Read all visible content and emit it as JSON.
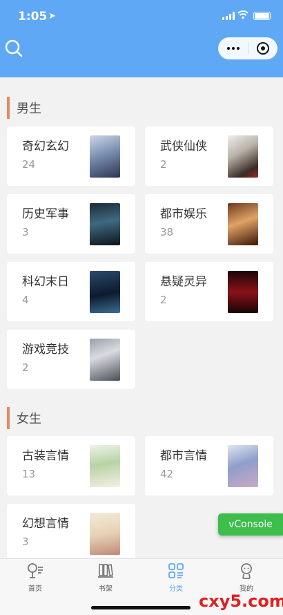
{
  "status": {
    "time": "1:05",
    "location_icon": "location-arrow-icon"
  },
  "header": {
    "bg_color": "#5fa8f5",
    "search_icon": "search-icon",
    "more_icon": "more-dots-icon",
    "close_icon": "mini-program-close-icon"
  },
  "sections": [
    {
      "title": "男生",
      "items": [
        {
          "name": "奇幻玄幻",
          "count": "24"
        },
        {
          "name": "武侠仙侠",
          "count": "2"
        },
        {
          "name": "历史军事",
          "count": "3"
        },
        {
          "name": "都市娱乐",
          "count": "38"
        },
        {
          "name": "科幻末日",
          "count": "4"
        },
        {
          "name": "悬疑灵异",
          "count": "2"
        },
        {
          "name": "游戏竞技",
          "count": "2"
        }
      ]
    },
    {
      "title": "女生",
      "items": [
        {
          "name": "古装言情",
          "count": "13"
        },
        {
          "name": "都市言情",
          "count": "42"
        },
        {
          "name": "幻想言情",
          "count": "3"
        }
      ]
    }
  ],
  "vconsole": {
    "label": "vConsole",
    "color": "#3dbd4b"
  },
  "tabbar": {
    "active_color": "#5fa8f5",
    "tabs": [
      {
        "label": "首页",
        "icon": "home-icon"
      },
      {
        "label": "书架",
        "icon": "bookshelf-icon"
      },
      {
        "label": "分类",
        "icon": "category-icon",
        "active": true
      },
      {
        "label": "我的",
        "icon": "profile-icon"
      }
    ]
  },
  "watermark": "cxy5.com"
}
